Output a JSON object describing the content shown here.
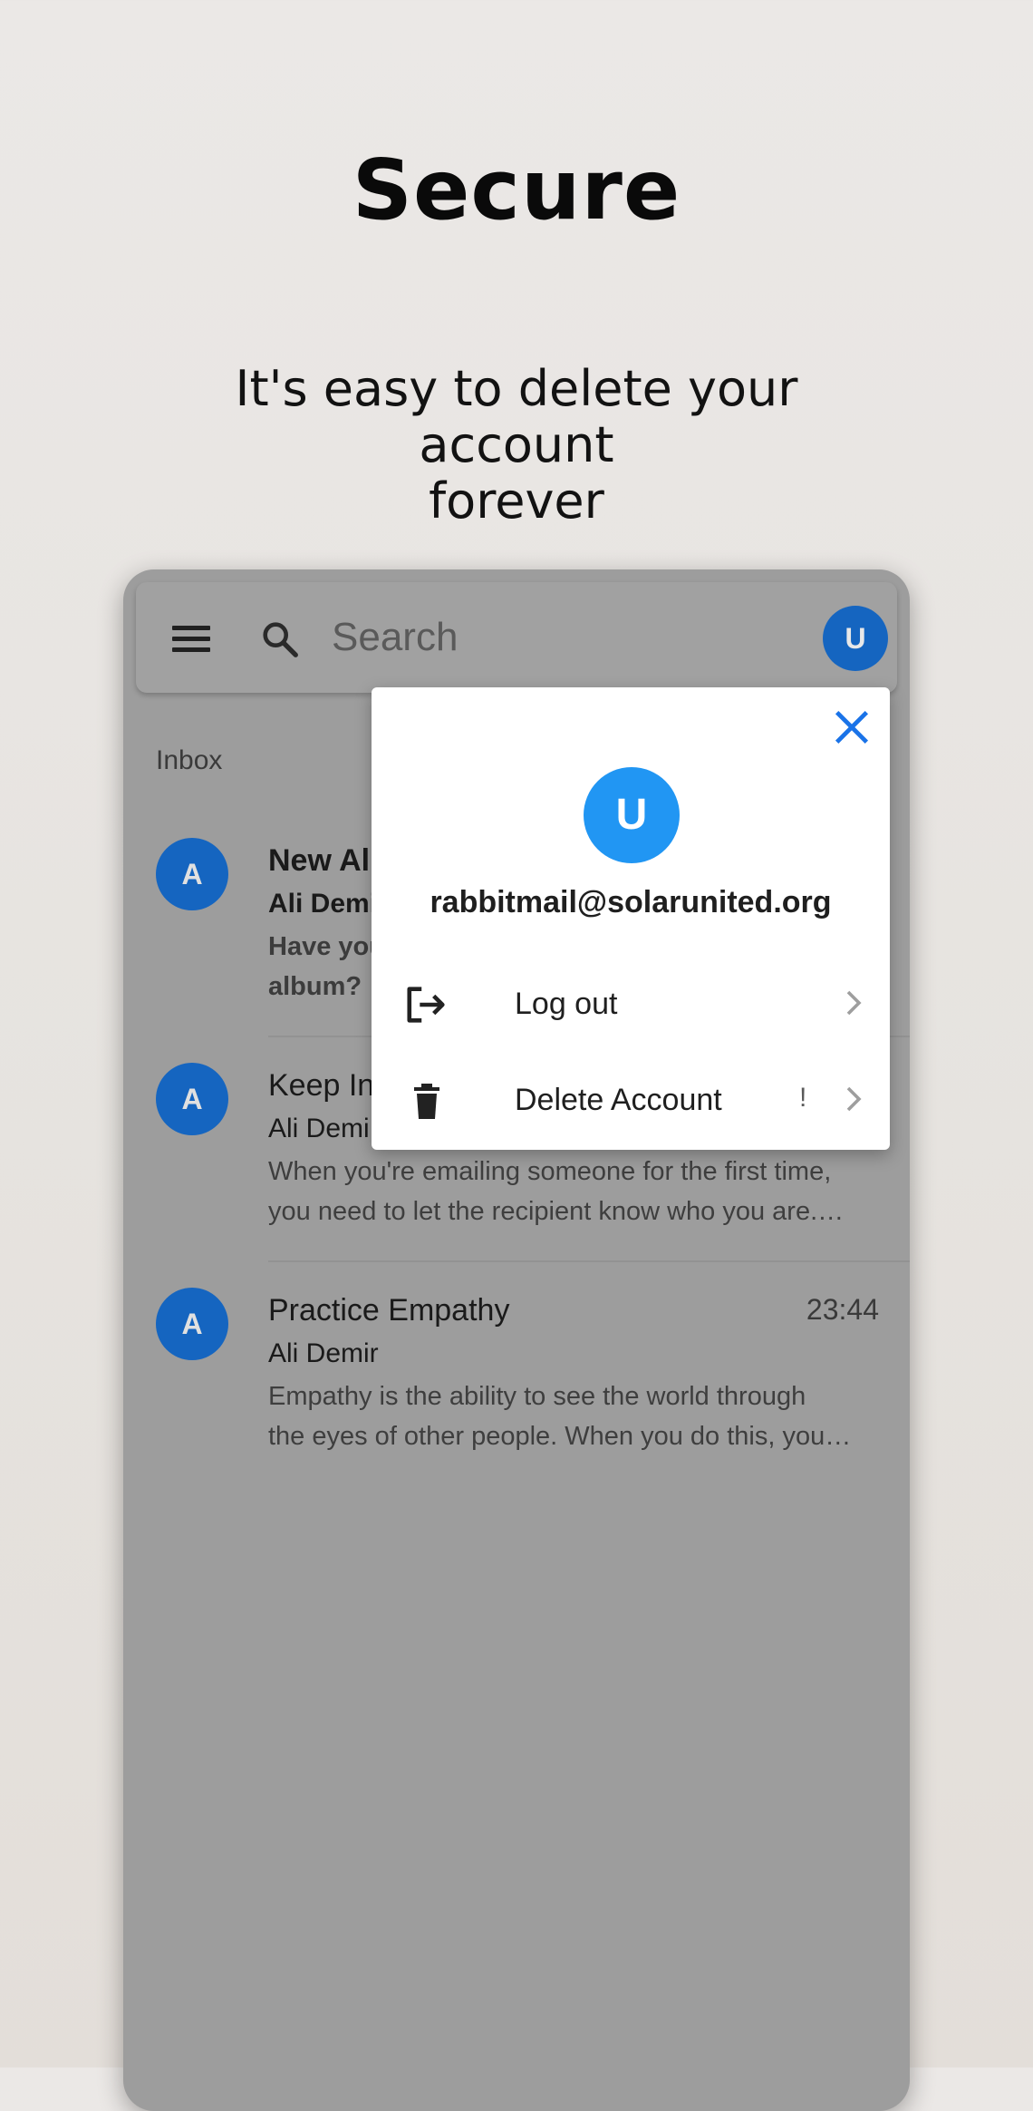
{
  "promo": {
    "title": "Secure",
    "subtitle_line1": "It's easy to delete your account",
    "subtitle_line2": "forever"
  },
  "header": {
    "search_placeholder": "Search",
    "avatar_letter": "U",
    "menu_icon": "hamburger-menu-icon",
    "search_icon": "search-icon"
  },
  "inbox": {
    "label": "Inbox",
    "emails": [
      {
        "avatar": "A",
        "subject": "New Al",
        "sender": "Ali Demi",
        "preview_line1": "Have you",
        "preview_line2": "album?",
        "unread": true
      },
      {
        "avatar": "A",
        "subject": "Keep In",
        "sender": "Ali Demi",
        "preview_line1": "When you're emailing someone for the first time,",
        "preview_line2": "you need to let the recipient know who you are.…",
        "unread": false
      },
      {
        "avatar": "A",
        "subject": "Practice Empathy",
        "time": "23:44",
        "sender": "Ali Demir",
        "preview_line1": "Empathy is the ability to see the world through",
        "preview_line2": "the eyes of other people. When you do this, you…",
        "unread": false
      }
    ]
  },
  "account_popup": {
    "avatar_letter": "U",
    "email": "rabbitmail@solarunited.org",
    "items": [
      {
        "label": "Log out",
        "icon": "logout-icon"
      },
      {
        "label": "Delete Account",
        "icon": "trash-icon",
        "warning": "!"
      }
    ],
    "close_icon": "close-icon"
  },
  "colors": {
    "accent_blue": "#1a73e8",
    "avatar_blue": "#2196f3",
    "dim_overlay": "#9d9d9d"
  }
}
